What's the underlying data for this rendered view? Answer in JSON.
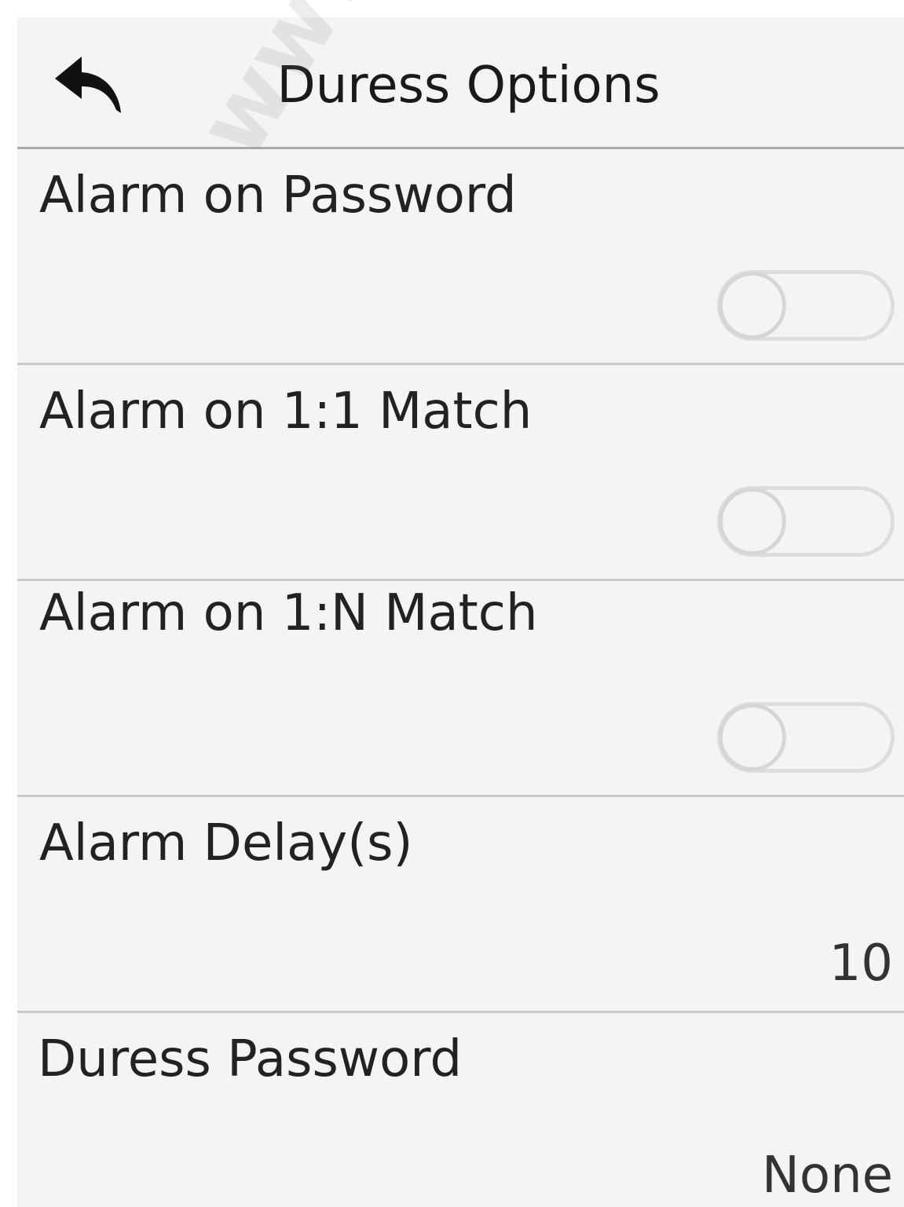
{
  "header": {
    "title": "Duress Options",
    "back_icon": "back-arrow-icon"
  },
  "rows": [
    {
      "label": "Alarm on Password",
      "control": "toggle",
      "enabled": false
    },
    {
      "label": "Alarm on 1:1 Match",
      "control": "toggle",
      "enabled": false
    },
    {
      "label": "Alarm on 1:N Match",
      "control": "toggle",
      "enabled": false
    },
    {
      "label": "Alarm Delay(s)",
      "control": "value",
      "value": "10"
    },
    {
      "label": "Duress Password",
      "control": "value",
      "value": "None"
    }
  ],
  "watermark": {
    "text": "www.us-plas"
  },
  "colors": {
    "background": "#f4f4f4",
    "divider": "#c9c9c9",
    "text": "#222222",
    "toggle_off": "#dddddd"
  }
}
